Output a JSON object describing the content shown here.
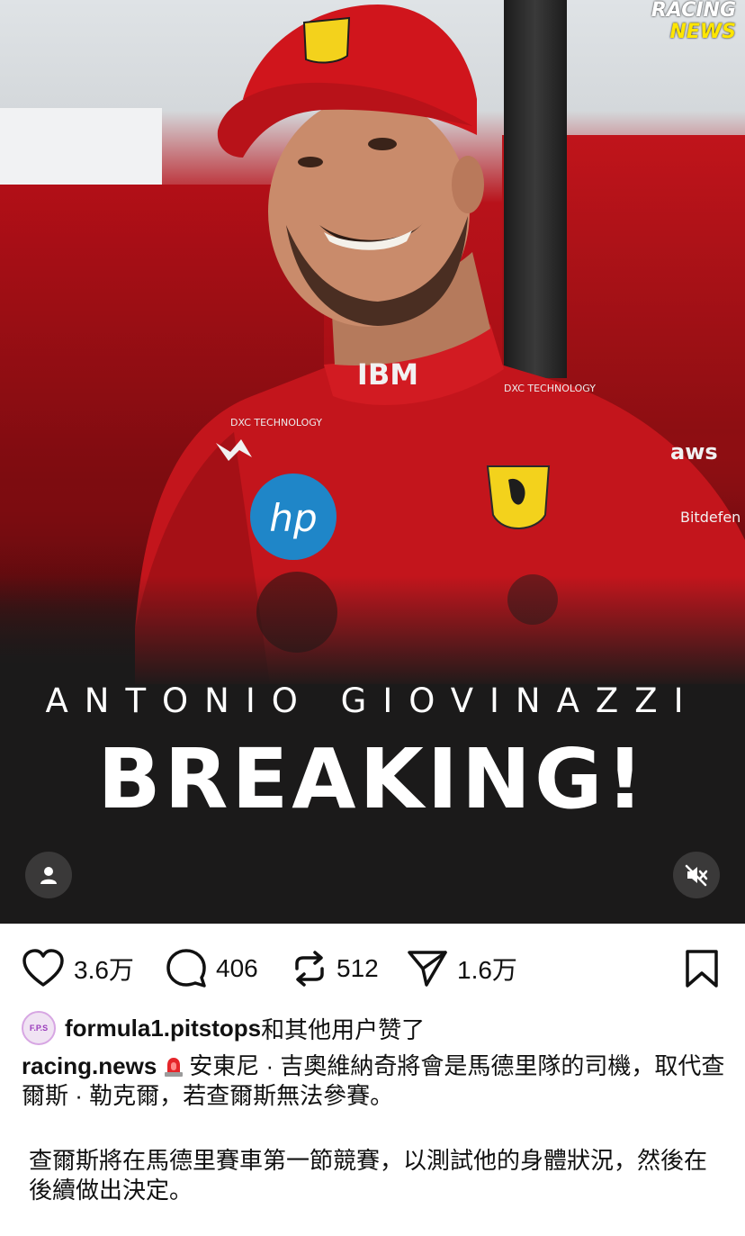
{
  "post": {
    "brand": {
      "line1": "RACING",
      "line2": "NEWS"
    },
    "subtitle": "ANTONIO GIOVINAZZI",
    "headline": "BREAKING!"
  },
  "actions": {
    "likes": "3.6万",
    "comments": "406",
    "reposts": "512",
    "shares": "1.6万"
  },
  "liked_by": {
    "avatar_text": "F.P.S",
    "username": "formula1.pitstops",
    "suffix": "和其他用户赞了"
  },
  "caption": {
    "author": "racing.news",
    "line1": "安東尼 · 吉奧維納奇將會是馬德里隊的司機，取代查爾斯 · 勒克爾，若查爾斯無法參賽。",
    "line2": "查爾斯將在馬德里賽車第一節競賽，以測試他的身體狀況，然後在後續做出決定。"
  },
  "icons": {
    "user": "user-icon",
    "mute": "speaker-muted-icon",
    "like": "heart-icon",
    "comment": "comment-bubble-icon",
    "repost": "repost-icon",
    "share": "send-icon",
    "bookmark": "bookmark-icon",
    "siren": "siren-icon"
  }
}
